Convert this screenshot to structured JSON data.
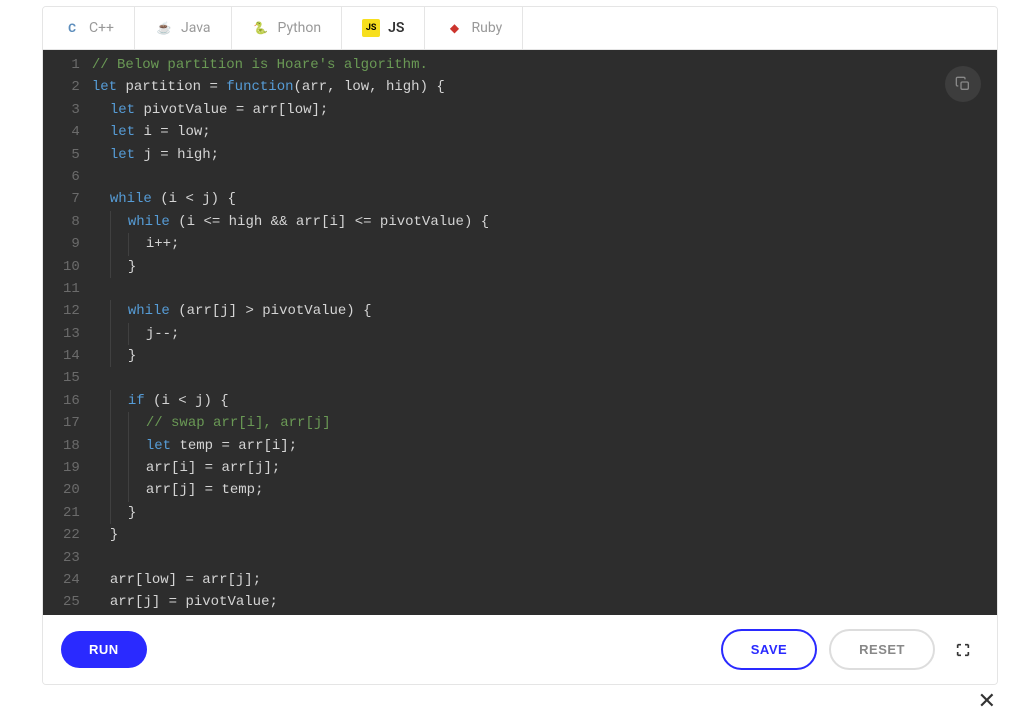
{
  "tabs": [
    {
      "label": "C++",
      "icon": "cpp",
      "active": false
    },
    {
      "label": "Java",
      "icon": "java",
      "active": false
    },
    {
      "label": "Python",
      "icon": "python",
      "active": false
    },
    {
      "label": "JS",
      "icon": "js",
      "active": true
    },
    {
      "label": "Ruby",
      "icon": "ruby",
      "active": false
    }
  ],
  "code": [
    {
      "n": 1,
      "indent": 0,
      "tokens": [
        [
          "comment",
          "// Below partition is Hoare's algorithm."
        ]
      ]
    },
    {
      "n": 2,
      "indent": 0,
      "tokens": [
        [
          "keyword",
          "let"
        ],
        [
          "punct",
          " "
        ],
        [
          "ident",
          "partition"
        ],
        [
          "punct",
          " = "
        ],
        [
          "keyword",
          "function"
        ],
        [
          "punct",
          "("
        ],
        [
          "ident",
          "arr"
        ],
        [
          "punct",
          ", "
        ],
        [
          "ident",
          "low"
        ],
        [
          "punct",
          ", "
        ],
        [
          "ident",
          "high"
        ],
        [
          "punct",
          ") {"
        ]
      ]
    },
    {
      "n": 3,
      "indent": 1,
      "tokens": [
        [
          "keyword",
          "let"
        ],
        [
          "punct",
          " "
        ],
        [
          "ident",
          "pivotValue"
        ],
        [
          "punct",
          " = "
        ],
        [
          "ident",
          "arr"
        ],
        [
          "punct",
          "["
        ],
        [
          "ident",
          "low"
        ],
        [
          "punct",
          "];"
        ]
      ]
    },
    {
      "n": 4,
      "indent": 1,
      "tokens": [
        [
          "keyword",
          "let"
        ],
        [
          "punct",
          " "
        ],
        [
          "ident",
          "i"
        ],
        [
          "punct",
          " = "
        ],
        [
          "ident",
          "low"
        ],
        [
          "punct",
          ";"
        ]
      ]
    },
    {
      "n": 5,
      "indent": 1,
      "tokens": [
        [
          "keyword",
          "let"
        ],
        [
          "punct",
          " "
        ],
        [
          "ident",
          "j"
        ],
        [
          "punct",
          " = "
        ],
        [
          "ident",
          "high"
        ],
        [
          "punct",
          ";"
        ]
      ]
    },
    {
      "n": 6,
      "indent": 0,
      "tokens": []
    },
    {
      "n": 7,
      "indent": 1,
      "tokens": [
        [
          "keyword",
          "while"
        ],
        [
          "punct",
          " ("
        ],
        [
          "ident",
          "i"
        ],
        [
          "punct",
          " < "
        ],
        [
          "ident",
          "j"
        ],
        [
          "punct",
          ") {"
        ]
      ]
    },
    {
      "n": 8,
      "indent": 2,
      "tokens": [
        [
          "keyword",
          "while"
        ],
        [
          "punct",
          " ("
        ],
        [
          "ident",
          "i"
        ],
        [
          "punct",
          " <= "
        ],
        [
          "ident",
          "high"
        ],
        [
          "punct",
          " && "
        ],
        [
          "ident",
          "arr"
        ],
        [
          "punct",
          "["
        ],
        [
          "ident",
          "i"
        ],
        [
          "punct",
          "] <= "
        ],
        [
          "ident",
          "pivotValue"
        ],
        [
          "punct",
          ") {"
        ]
      ]
    },
    {
      "n": 9,
      "indent": 3,
      "tokens": [
        [
          "ident",
          "i"
        ],
        [
          "punct",
          "++;"
        ]
      ]
    },
    {
      "n": 10,
      "indent": 2,
      "tokens": [
        [
          "punct",
          "}"
        ]
      ]
    },
    {
      "n": 11,
      "indent": 0,
      "tokens": []
    },
    {
      "n": 12,
      "indent": 2,
      "tokens": [
        [
          "keyword",
          "while"
        ],
        [
          "punct",
          " ("
        ],
        [
          "ident",
          "arr"
        ],
        [
          "punct",
          "["
        ],
        [
          "ident",
          "j"
        ],
        [
          "punct",
          "] > "
        ],
        [
          "ident",
          "pivotValue"
        ],
        [
          "punct",
          ") {"
        ]
      ]
    },
    {
      "n": 13,
      "indent": 3,
      "tokens": [
        [
          "ident",
          "j"
        ],
        [
          "punct",
          "--;"
        ]
      ]
    },
    {
      "n": 14,
      "indent": 2,
      "tokens": [
        [
          "punct",
          "}"
        ]
      ]
    },
    {
      "n": 15,
      "indent": 0,
      "tokens": []
    },
    {
      "n": 16,
      "indent": 2,
      "tokens": [
        [
          "keyword",
          "if"
        ],
        [
          "punct",
          " ("
        ],
        [
          "ident",
          "i"
        ],
        [
          "punct",
          " < "
        ],
        [
          "ident",
          "j"
        ],
        [
          "punct",
          ") {"
        ]
      ]
    },
    {
      "n": 17,
      "indent": 3,
      "tokens": [
        [
          "comment",
          "// swap arr[i], arr[j]"
        ]
      ]
    },
    {
      "n": 18,
      "indent": 3,
      "tokens": [
        [
          "keyword",
          "let"
        ],
        [
          "punct",
          " "
        ],
        [
          "ident",
          "temp"
        ],
        [
          "punct",
          " = "
        ],
        [
          "ident",
          "arr"
        ],
        [
          "punct",
          "["
        ],
        [
          "ident",
          "i"
        ],
        [
          "punct",
          "];"
        ]
      ]
    },
    {
      "n": 19,
      "indent": 3,
      "tokens": [
        [
          "ident",
          "arr"
        ],
        [
          "punct",
          "["
        ],
        [
          "ident",
          "i"
        ],
        [
          "punct",
          "] = "
        ],
        [
          "ident",
          "arr"
        ],
        [
          "punct",
          "["
        ],
        [
          "ident",
          "j"
        ],
        [
          "punct",
          "];"
        ]
      ]
    },
    {
      "n": 20,
      "indent": 3,
      "tokens": [
        [
          "ident",
          "arr"
        ],
        [
          "punct",
          "["
        ],
        [
          "ident",
          "j"
        ],
        [
          "punct",
          "] = "
        ],
        [
          "ident",
          "temp"
        ],
        [
          "punct",
          ";"
        ]
      ]
    },
    {
      "n": 21,
      "indent": 2,
      "tokens": [
        [
          "punct",
          "}"
        ]
      ]
    },
    {
      "n": 22,
      "indent": 1,
      "tokens": [
        [
          "punct",
          "}"
        ]
      ]
    },
    {
      "n": 23,
      "indent": 0,
      "tokens": []
    },
    {
      "n": 24,
      "indent": 1,
      "tokens": [
        [
          "ident",
          "arr"
        ],
        [
          "punct",
          "["
        ],
        [
          "ident",
          "low"
        ],
        [
          "punct",
          "] = "
        ],
        [
          "ident",
          "arr"
        ],
        [
          "punct",
          "["
        ],
        [
          "ident",
          "j"
        ],
        [
          "punct",
          "];"
        ]
      ]
    },
    {
      "n": 25,
      "indent": 1,
      "tokens": [
        [
          "ident",
          "arr"
        ],
        [
          "punct",
          "["
        ],
        [
          "ident",
          "j"
        ],
        [
          "punct",
          "] = "
        ],
        [
          "ident",
          "pivotValue"
        ],
        [
          "punct",
          ";"
        ]
      ]
    }
  ],
  "buttons": {
    "run": "RUN",
    "save": "SAVE",
    "reset": "RESET"
  },
  "icons": {
    "cpp_glyph": "C",
    "java_glyph": "☕",
    "python_glyph": "🐍",
    "js_glyph": "JS",
    "ruby_glyph": "◆"
  }
}
